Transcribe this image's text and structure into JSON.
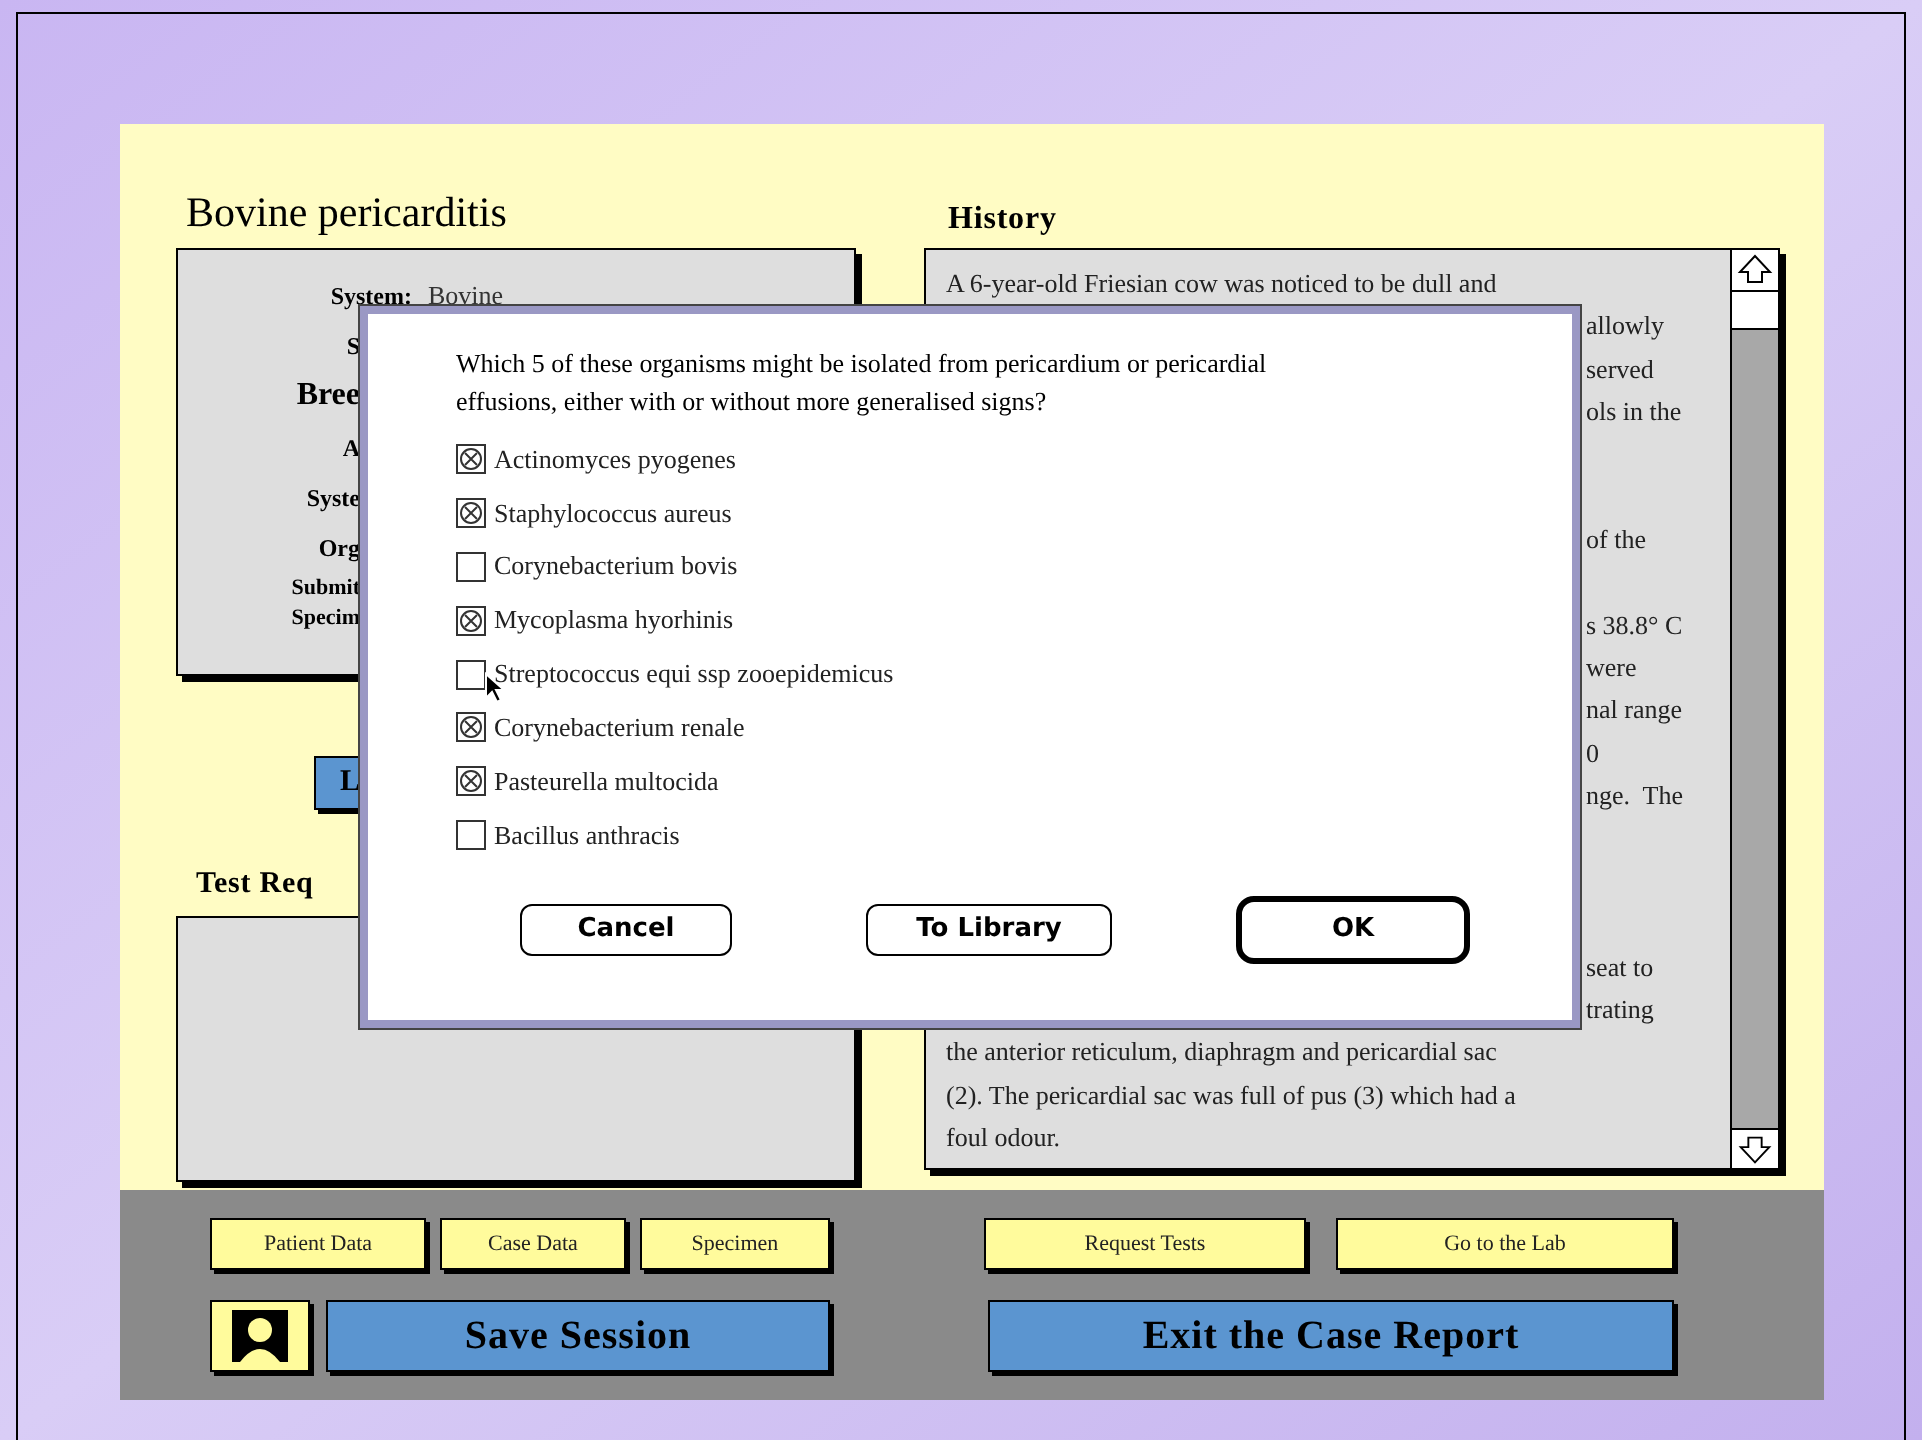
{
  "case_title": "Bovine pericarditis",
  "details": {
    "rows": [
      {
        "label": "System:",
        "value": "Bovine"
      },
      {
        "label": "S"
      },
      {
        "label": "Bree",
        "kind": "large"
      },
      {
        "label": "A"
      },
      {
        "label": "Syste"
      },
      {
        "label": "Org"
      },
      {
        "label": "Submit",
        "kind": "small"
      },
      {
        "label": "Specim",
        "kind": "small"
      }
    ]
  },
  "left_button": "L",
  "test_requests": {
    "heading": "Test Req"
  },
  "history": {
    "heading": "History",
    "lines": [
      {
        "kind": "full",
        "text": "A 6-year-old Friesian cow was noticed to be dull and"
      },
      {
        "kind": "tail",
        "text": "allowly"
      },
      {
        "kind": "tail",
        "text": "served"
      },
      {
        "kind": "tail",
        "text": "ols in the"
      },
      {
        "kind": "covered"
      },
      {
        "kind": "covered"
      },
      {
        "kind": "tail",
        "text": "of the"
      },
      {
        "kind": "covered"
      },
      {
        "kind": "tail",
        "text": "s 38.8° C"
      },
      {
        "kind": "tail",
        "text": "were"
      },
      {
        "kind": "tail",
        "text": "nal range"
      },
      {
        "kind": "tail",
        "text": "0"
      },
      {
        "kind": "tail",
        "text": "nge.  The"
      },
      {
        "kind": "covered"
      },
      {
        "kind": "covered"
      },
      {
        "kind": "covered"
      },
      {
        "kind": "tail",
        "text": "seat to"
      },
      {
        "kind": "tail",
        "text": "trating"
      },
      {
        "kind": "full",
        "text": "the anterior reticulum, diaphragm and pericardial sac"
      },
      {
        "kind": "full",
        "text": "(2). The pericardial sac was full of pus (3) which had a"
      },
      {
        "kind": "full",
        "text": "foul odour."
      }
    ]
  },
  "dialog": {
    "question": "Which 5 of these organisms might be isolated from pericardium or pericardial effusions, either with or without more generalised signs?",
    "options": [
      {
        "label": "Actinomyces pyogenes",
        "checked": true
      },
      {
        "label": "Staphylococcus aureus",
        "checked": true
      },
      {
        "label": "Corynebacterium bovis",
        "checked": false
      },
      {
        "label": "Mycoplasma hyorhinis",
        "checked": true
      },
      {
        "label": "Streptococcus equi ssp zooepidemicus",
        "checked": false
      },
      {
        "label": "Corynebacterium renale",
        "checked": true
      },
      {
        "label": "Pasteurella multocida",
        "checked": true
      },
      {
        "label": "Bacillus anthracis",
        "checked": false
      }
    ],
    "buttons": [
      {
        "label": "Cancel",
        "default": false
      },
      {
        "label": "To Library",
        "default": false
      },
      {
        "label": "OK",
        "default": true
      }
    ]
  },
  "data_buttons": [
    "Patient Data",
    "Case Data",
    "Specimen"
  ],
  "lab_buttons": [
    "Request Tests",
    "Go to the Lab"
  ],
  "save_button": "Save Session",
  "exit_button": "Exit the Case Report"
}
